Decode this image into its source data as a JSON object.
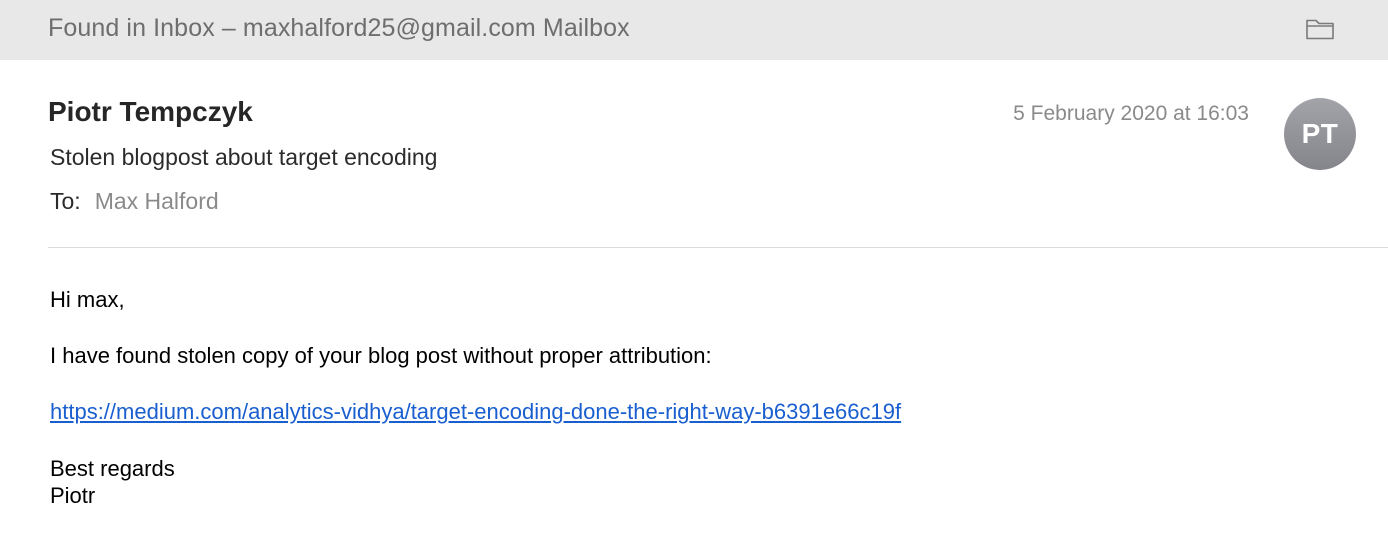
{
  "banner": {
    "text": "Found in Inbox – maxhalford25@gmail.com Mailbox"
  },
  "icons": {
    "folder": "folder-icon"
  },
  "header": {
    "sender": "Piotr Tempczyk",
    "date": "5 February 2020 at 16:03",
    "subject": "Stolen blogpost about target encoding",
    "to_label": "To:",
    "to_value": "Max Halford",
    "avatar_initials": "PT"
  },
  "body": {
    "greeting": "Hi max,",
    "line1": "I have found stolen copy of your blog post without proper attribution:",
    "link": "https://medium.com/analytics-vidhya/target-encoding-done-the-right-way-b6391e66c19f",
    "signoff": "Best regards",
    "signature": "Piotr"
  },
  "colors": {
    "banner_bg": "#e8e8e8",
    "link": "#1a5fd0",
    "avatar_bg": "#9a9ba0",
    "muted_text": "#8a8a8a"
  }
}
